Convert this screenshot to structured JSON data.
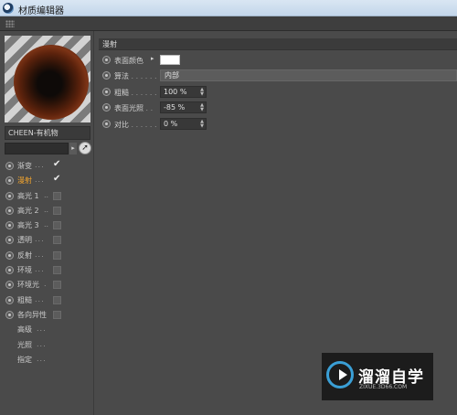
{
  "window": {
    "title": "材质编辑器"
  },
  "material": {
    "name": "CHEEN-有机物"
  },
  "channels": [
    {
      "label": "渐变",
      "dots": "...",
      "checked": true,
      "active": false
    },
    {
      "label": "漫射",
      "dots": "...",
      "checked": true,
      "active": true
    },
    {
      "label": "高光 1",
      "dots": "..",
      "checked": false,
      "active": false
    },
    {
      "label": "高光 2",
      "dots": "..",
      "checked": false,
      "active": false
    },
    {
      "label": "高光 3",
      "dots": "..",
      "checked": false,
      "active": false
    },
    {
      "label": "透明",
      "dots": "...",
      "checked": false,
      "active": false
    },
    {
      "label": "反射",
      "dots": "...",
      "checked": false,
      "active": false
    },
    {
      "label": "环境",
      "dots": "...",
      "checked": false,
      "active": false
    },
    {
      "label": "环境光",
      "dots": ".",
      "checked": false,
      "active": false
    },
    {
      "label": "粗糙",
      "dots": "...",
      "checked": false,
      "active": false
    },
    {
      "label": "各向异性",
      "dots": "",
      "checked": false,
      "active": false
    },
    {
      "label": "高级",
      "dots": "...",
      "checked": null,
      "active": false
    },
    {
      "label": "光照",
      "dots": "...",
      "checked": null,
      "active": false
    },
    {
      "label": "指定",
      "dots": "...",
      "checked": null,
      "active": false
    }
  ],
  "diffuse": {
    "section_title": "漫射",
    "surface_color": {
      "label": "表面颜色",
      "dots": ".",
      "value": "#ffffff"
    },
    "algorithm": {
      "label": "算法",
      "dots": ". . . . . .",
      "value": "内部"
    },
    "roughness": {
      "label": "粗糙",
      "dots": ". . . . . .",
      "value": "100 %"
    },
    "surface_light": {
      "label": "表面光照",
      "dots": ". .",
      "value": "-85 %"
    },
    "contrast": {
      "label": "对比",
      "dots": ". . . . . .",
      "value": "0 %"
    }
  },
  "watermark": {
    "text": "溜溜自学",
    "url": "ZIXUE.3D66.COM"
  },
  "colors": {
    "accent_active": "#f0a32e",
    "panel_bg": "#4a4a4a",
    "watermark_blue": "#3a9fd6"
  }
}
